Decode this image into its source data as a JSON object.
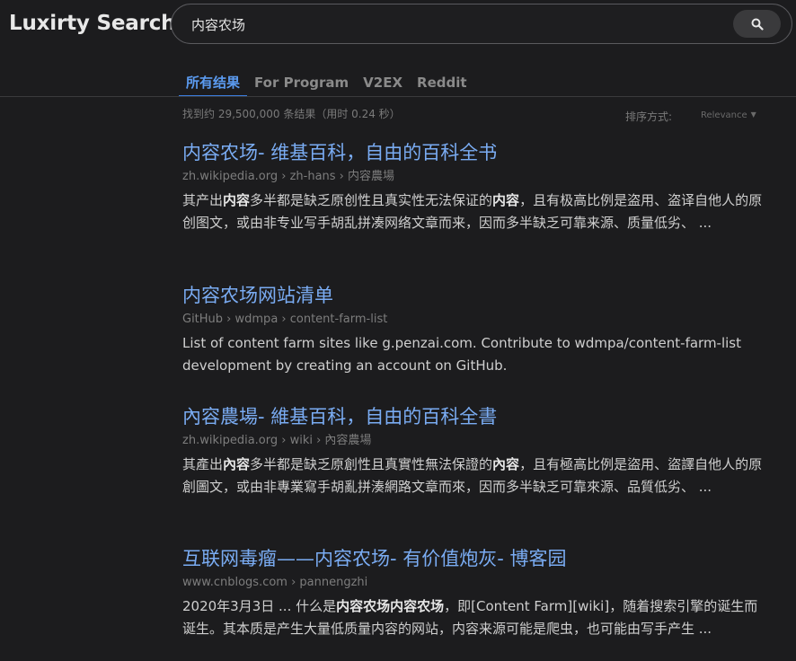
{
  "header": {
    "brand": "Luxirty Search",
    "search_value": "内容农场",
    "search_button_icon": "search-icon"
  },
  "tabs": [
    {
      "label": "所有结果",
      "active": true
    },
    {
      "label": "For Program",
      "active": false
    },
    {
      "label": "V2EX",
      "active": false
    },
    {
      "label": "Reddit",
      "active": false
    }
  ],
  "stats": "找到约 29,500,000 条结果（用时 0.24 秒）",
  "sort": {
    "label": "排序方式:",
    "value": "Relevance"
  },
  "results": [
    {
      "title": "内容农场- 维基百科，自由的百科全书",
      "url": "zh.wikipedia.org › zh-hans › 内容農場",
      "snippet": [
        {
          "t": "其产出",
          "b": false
        },
        {
          "t": "内容",
          "b": true
        },
        {
          "t": "多半都是缺乏原创性且真实性无法保证的",
          "b": false
        },
        {
          "t": "内容",
          "b": true
        },
        {
          "t": "，且有极高比例是盗用、盗译自他人的原创图文，或由非专业写手胡乱拼凑网络文章而来，因而多半缺乏可靠来源、质量低劣、 ...",
          "b": false
        }
      ]
    },
    {
      "title": "内容农场网站清单",
      "url": "GitHub › wdmpa › content-farm-list",
      "snippet": [
        {
          "t": "List of content farm sites like g.penzai.com. Contribute to wdmpa/content-farm-list development by creating an account on GitHub.",
          "b": false
        }
      ]
    },
    {
      "title": "內容農場- 維基百科，自由的百科全書",
      "url": "zh.wikipedia.org › wiki › 內容農場",
      "snippet": [
        {
          "t": "其產出",
          "b": false
        },
        {
          "t": "內容",
          "b": true
        },
        {
          "t": "多半都是缺乏原創性且真實性無法保證的",
          "b": false
        },
        {
          "t": "內容",
          "b": true
        },
        {
          "t": "，且有極高比例是盜用、盜譯自他人的原創圖文，或由非專業寫手胡亂拼湊網路文章而來，因而多半缺乏可靠來源、品質低劣、 ...",
          "b": false
        }
      ]
    },
    {
      "title": "互联网毒瘤——内容农场- 有价值炮灰- 博客园",
      "url": "www.cnblogs.com › pannengzhi",
      "snippet": [
        {
          "t": "2020年3月3日 ... 什么是",
          "b": false
        },
        {
          "t": "内容农场内容农场",
          "b": true
        },
        {
          "t": "，即[Content Farm][wiki]，随着搜索引擎的诞生而诞生。其本质是产生大量低质量内容的网站，内容来源可能是爬虫，也可能由写手产生 ...",
          "b": false
        }
      ]
    }
  ],
  "colors": {
    "background": "#1c1c1e",
    "link": "#7aacf3",
    "active_tab": "#5b9bf0"
  }
}
